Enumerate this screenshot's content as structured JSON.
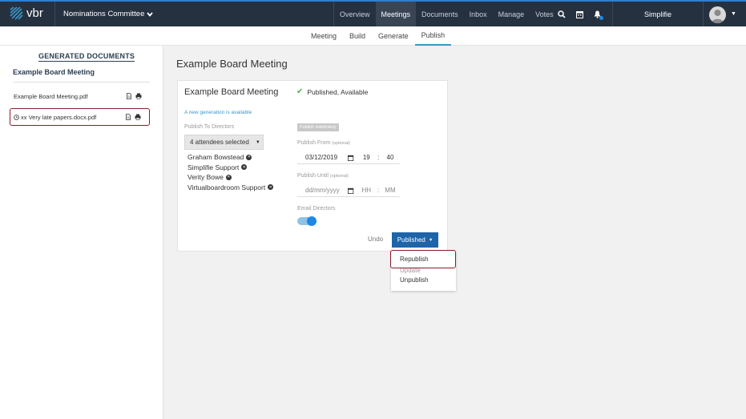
{
  "app": {
    "logo_text": "vbr",
    "committee": "Nominations Committee"
  },
  "nav": {
    "items": [
      "Overview",
      "Meetings",
      "Documents",
      "Inbox",
      "Manage",
      "Votes"
    ],
    "active": "Meetings"
  },
  "user": {
    "name": "Simplifie"
  },
  "subnav": {
    "items": [
      "Meeting",
      "Build",
      "Generate",
      "Publish"
    ],
    "active": "Publish"
  },
  "sidebar": {
    "title": "GENERATED DOCUMENTS",
    "meeting": "Example Board Meeting",
    "docs": [
      "Example Board Meeting.pdf",
      "xx Very late papers.docx.pdf"
    ]
  },
  "main": {
    "page_title": "Example Board Meeting",
    "card": {
      "title": "Example Board Meeting",
      "status": "Published, Available",
      "new_generation": "A new generation is available",
      "publish_to_label": "Publish To Directors",
      "attendees_button": "4 attendees selected",
      "attendees": [
        "Graham Bowstead",
        "Simplifie Support",
        "Verity Bowe",
        "Virtualboardroom Support"
      ],
      "publish_indefinitely": "Publish indefinitely",
      "publish_from_label": "Publish From",
      "optional": "(optional)",
      "publish_from": {
        "date": "03/12/2019",
        "hour": "19",
        "minute": "40"
      },
      "publish_until_label": "Publish Until",
      "publish_until": {
        "date_placeholder": "dd/mm/yyyy",
        "hour_placeholder": "HH",
        "minute_placeholder": "MM"
      },
      "email_label": "Email Directors",
      "email_on": true,
      "undo": "Undo",
      "published_button": "Published"
    },
    "dropdown": [
      "Republish",
      "Update",
      "Unpublish"
    ]
  },
  "colors": {
    "topbar": "#263140",
    "accent": "#1e64a8",
    "highlight": "#8a1c2b",
    "success": "#4caf50"
  }
}
